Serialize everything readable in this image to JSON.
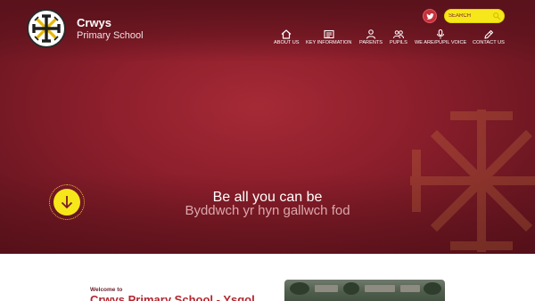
{
  "brand": {
    "name": "Crwys",
    "subtitle": "Primary School",
    "logo_icon": "cross-badge-icon"
  },
  "colors": {
    "primary": "#8e1f2c",
    "dark": "#5a121c",
    "accent": "#f6e71a",
    "title_red": "#b3262f"
  },
  "social": {
    "twitter_icon": "twitter-icon"
  },
  "search": {
    "placeholder": "SEARCH"
  },
  "nav": {
    "items": [
      {
        "label": "ABOUT US",
        "icon": "home-icon"
      },
      {
        "label": "KEY INFORMATION",
        "icon": "info-card-icon"
      },
      {
        "label": "PARENTS",
        "icon": "person-icon"
      },
      {
        "label": "PUPILS",
        "icon": "group-icon"
      },
      {
        "label": "WE ARE/PUPIL VOICE",
        "icon": "microphone-icon"
      },
      {
        "label": "CONTACT US",
        "icon": "pencil-icon"
      }
    ]
  },
  "hero": {
    "tagline": "Be all you can be",
    "tagline_welsh": "Byddwch yr hyn gallwch fod",
    "scroll_icon": "arrow-down-icon"
  },
  "welcome": {
    "kicker": "Welcome to",
    "title": "Crwys Primary School - Ysgol"
  }
}
